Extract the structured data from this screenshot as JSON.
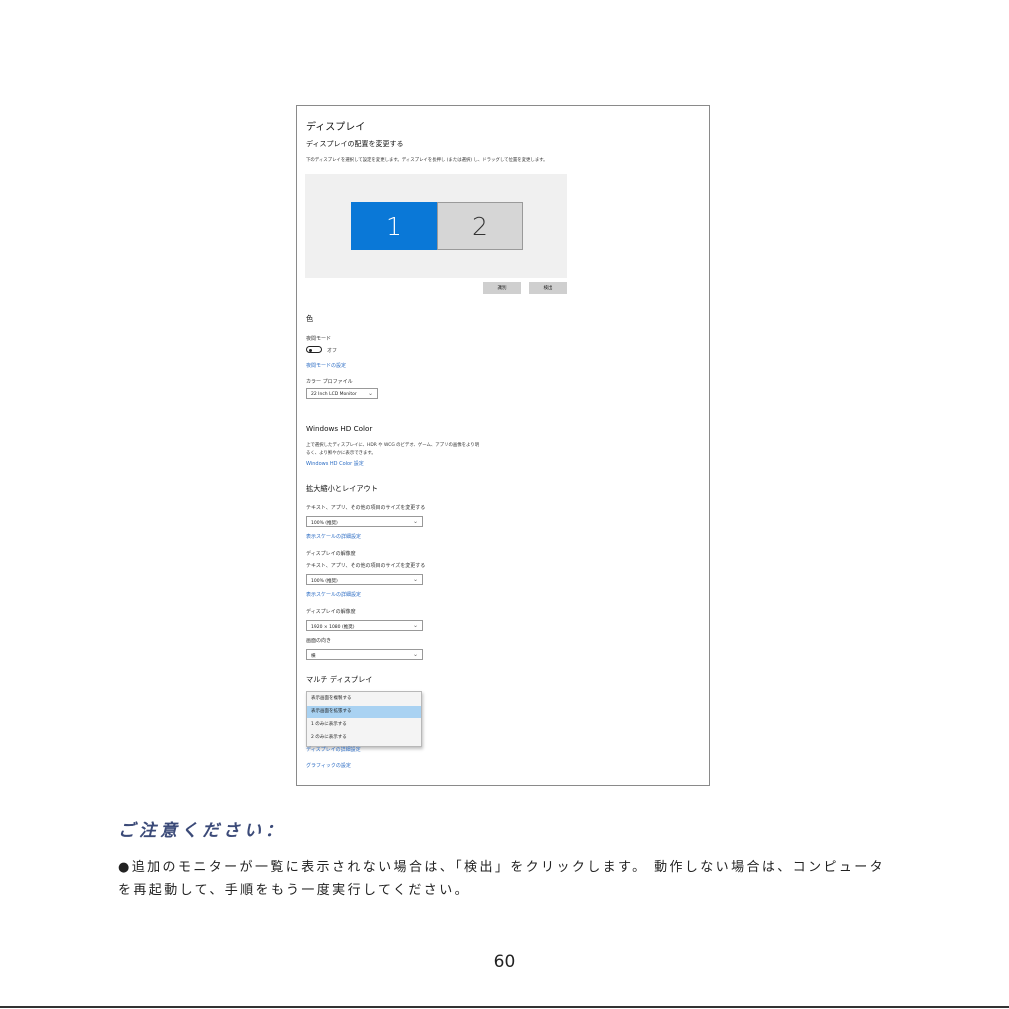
{
  "settings": {
    "page_title": "ディスプレイ",
    "arrange_heading": "ディスプレイの配置を変更する",
    "arrange_desc": "下のディスプレイを選択して設定を変更します。ディスプレイを長押し (または選択) し、ドラッグして位置を変更します。",
    "monitors": [
      "1",
      "2"
    ],
    "identify_label": "識別",
    "detect_label": "検出",
    "color_section": "色",
    "night_light_label": "夜間モード",
    "night_light_state": "オフ",
    "night_light_link": "夜間モードの設定",
    "color_profile_label": "カラー プロファイル",
    "color_profile_value": "22 Inch LCD Monitor",
    "hd_color_section": "Windows HD Color",
    "hd_color_desc_1": "上で選択したディスプレイに、HDR や WCG のビデオ、ゲーム、アプリの画像をより明",
    "hd_color_desc_2": "るく、より鮮やかに表示できます。",
    "hd_color_link": "Windows HD Color 設定",
    "scale_section": "拡大縮小とレイアウト",
    "scale_label_1": "テキスト、アプリ、その他の項目のサイズを変更する",
    "scale_value_1": "100% (推奨)",
    "scale_link_1": "表示スケールの詳細設定",
    "res_label_a": "ディスプレイの解像度",
    "scale_label_2": "テキスト、アプリ、その他の項目のサイズを変更する",
    "scale_value_2": "100% (推奨)",
    "scale_link_2": "表示スケールの詳細設定",
    "res_label_b": "ディスプレイの解像度",
    "res_value": "1920 × 1080 (推奨)",
    "orientation_label": "画面の向き",
    "orientation_value": "横",
    "multi_section": "マルチ ディスプレイ",
    "multi_options": [
      "表示画面を複製する",
      "表示画面を拡張する",
      "1 のみに表示する",
      "2 のみに表示する"
    ],
    "advanced_link": "ディスプレイの詳細設定",
    "graphics_link": "グラフィックの設定"
  },
  "note": {
    "title": "ご注意ください：",
    "body": "●追加のモニターが一覧に表示されない場合は、「検出」をクリックします。 動作しない場合は、コンピュータを再起動して、手順をもう一度実行してください。"
  },
  "page_number": "60",
  "colors": {
    "accent": "#0a78d7",
    "link": "#2b6cc4",
    "highlight": "#a9d2f2",
    "note_title": "#3b4a78"
  }
}
